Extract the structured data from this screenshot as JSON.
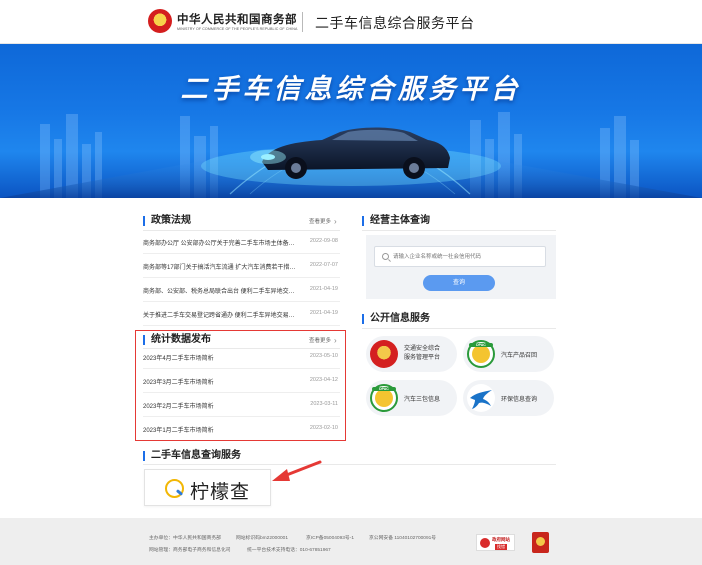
{
  "header": {
    "ministry_cn": "中华人民共和国商务部",
    "ministry_en": "MINISTRY OF COMMERCE OF THE PEOPLE'S REPUBLIC OF CHINA",
    "platform_title": "二手车信息综合服务平台"
  },
  "banner": {
    "title": "二手车信息综合服务平台"
  },
  "policy": {
    "title": "政策法规",
    "more": "查看更多",
    "items": [
      {
        "title": "商务部办公厅 公安部办公厅关于完善二手车市场主体备案...",
        "date": "2022-09-08"
      },
      {
        "title": "商务部等17部门关于搞活汽车流通 扩大汽车消费若干措施...",
        "date": "2022-07-07"
      },
      {
        "title": "商务部、公安部、税务总局联合出台 便利二手车异地交易...",
        "date": "2021-04-19"
      },
      {
        "title": "关于推进二手车交易登记跨省通办 便利二手车异地交易的...",
        "date": "2021-04-19"
      }
    ]
  },
  "stats": {
    "title": "统计数据发布",
    "more": "查看更多",
    "items": [
      {
        "title": "2023年4月二手车市场简析",
        "date": "2023-05-10"
      },
      {
        "title": "2023年3月二手车市场简析",
        "date": "2023-04-12"
      },
      {
        "title": "2023年2月二手车市场简析",
        "date": "2023-03-11"
      },
      {
        "title": "2023年1月二手车市场简析",
        "date": "2023-02-10"
      }
    ]
  },
  "entity_query": {
    "title": "经营主体查询",
    "placeholder": "请输入企业名称或统一社会信用代码",
    "button": "查询"
  },
  "public_services": {
    "title": "公开信息服务",
    "items": [
      {
        "label_line1": "交通安全综合",
        "label_line2": "服务管理平台",
        "icon": "police-emblem-icon"
      },
      {
        "label": "汽车产品召回",
        "icon": "dpac-icon"
      },
      {
        "label": "汽车三包信息",
        "icon": "dpac-icon"
      },
      {
        "label": "环保信息查询",
        "icon": "eagle-logo-icon"
      }
    ]
  },
  "used_car_query": {
    "title": "二手车信息查询服务",
    "card_label": "柠檬查"
  },
  "footer": {
    "sponsor": "主办单位：中华人民共和国商务部",
    "operator": "网站管理：商务部电子商务和信息化司",
    "site_id": "网站标识码bm22000001",
    "icp": "京ICP备05004093号-1",
    "police_record": "京公网安备 11040102700091号",
    "support": "统一平台技术支持电话：010-67851967",
    "badge1_line1": "政府网站",
    "badge1_line2": "找错"
  },
  "colors": {
    "accent": "#1c6ee8",
    "highlight_box": "#e53935",
    "button": "#5b9af0"
  }
}
